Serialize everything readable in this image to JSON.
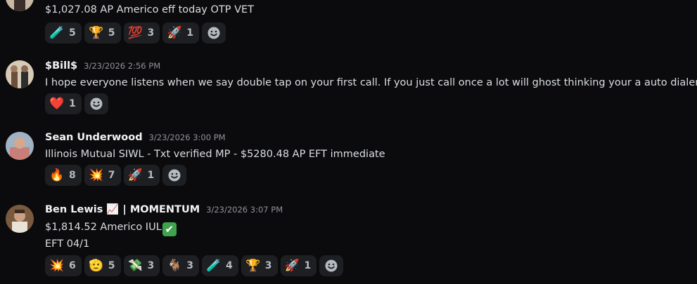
{
  "messages": [
    {
      "author": "",
      "timestamp": "",
      "lines": [
        "$1,027.08 AP Americo eff today OTP VET"
      ],
      "reactions": [
        {
          "emoji": "🧪",
          "count": "5"
        },
        {
          "emoji": "🏆",
          "count": "5"
        },
        {
          "emoji": "💯",
          "count": "3"
        },
        {
          "emoji": "🚀",
          "count": "1"
        }
      ]
    },
    {
      "author": "$Bill$",
      "timestamp": "3/23/2026 2:56 PM",
      "lines": [
        "I hope everyone listens when we say double tap on your first call. If you just call once a lot will ghost thinking your a auto dialer."
      ],
      "reactions": [
        {
          "emoji": "❤️",
          "count": "1"
        }
      ]
    },
    {
      "author": "Sean Underwood",
      "timestamp": "3/23/2026 3:00 PM",
      "lines": [
        "Illinois Mutual SIWL - Txt verified MP - $5280.48 AP EFT immediate"
      ],
      "reactions": [
        {
          "emoji": "🔥",
          "count": "8"
        },
        {
          "emoji": "💥",
          "count": "7"
        },
        {
          "emoji": "🚀",
          "count": "1"
        }
      ]
    },
    {
      "author": "Ben Lewis 📈 | MOMENTUM",
      "timestamp": "3/23/2026 3:07 PM",
      "lines": [
        "$1,814.52 Americo IUL",
        "EFT 04/1"
      ],
      "inline_emoji": "✔",
      "reactions": [
        {
          "emoji": "💥",
          "count": "6"
        },
        {
          "emoji": "🫡",
          "count": "5"
        },
        {
          "emoji": "💸",
          "count": "3"
        },
        {
          "emoji": "🐐",
          "count": "3"
        },
        {
          "emoji": "🧪",
          "count": "4"
        },
        {
          "emoji": "🏆",
          "count": "3"
        },
        {
          "emoji": "🚀",
          "count": "1"
        }
      ]
    }
  ],
  "icons": {
    "add_reaction": "smiley-face-icon"
  }
}
